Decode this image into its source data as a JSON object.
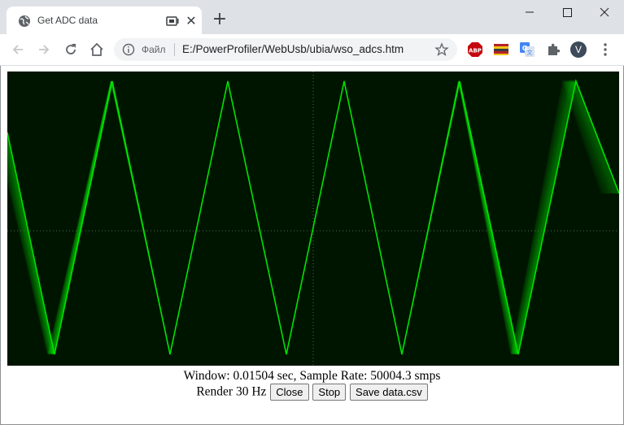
{
  "browser": {
    "tab_title": "Get ADC data",
    "omnibox": {
      "scheme_label": "Файл",
      "url": "E:/PowerProfiler/WebUsb/ubia/wso_adcs.htm"
    },
    "profile_initial": "V"
  },
  "page": {
    "scope": {
      "background_color": "#001500",
      "trace_color": "#00e000",
      "grid_color": "#4a6a4a"
    },
    "status": {
      "window_text": "Window: 0.01504 sec, Sample Rate: 50004.3 smps"
    },
    "controls": {
      "render_label": "Render 30 Hz",
      "close_label": "Close",
      "stop_label": "Stop",
      "save_label": "Save data.csv"
    }
  }
}
